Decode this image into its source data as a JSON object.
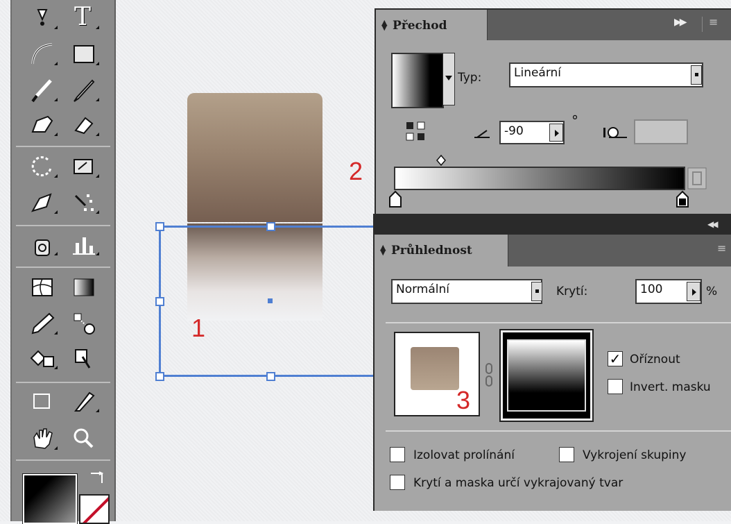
{
  "gradient_panel": {
    "tab_label": "Přechod",
    "type_label": "Typ:",
    "type_value": "Lineární",
    "angle_value": "-90",
    "degree_symbol": "°"
  },
  "transparency_panel": {
    "tab_label": "Průhlednost",
    "blend_mode": "Normální",
    "opacity_label": "Krytí:",
    "opacity_value": "100",
    "percent_sign": "%",
    "clip_label": "Oříznout",
    "clip_checked": true,
    "invert_mask_label": "Invert. masku",
    "isolate_blending_label": "Izolovat prolínání",
    "knockout_group_label": "Vykrojení skupiny",
    "opacity_mask_knockout_label": "Krytí a maska určí vykrajovaný tvar"
  },
  "callouts": {
    "one": "1",
    "two": "2",
    "three": "3"
  },
  "colors": {
    "selection": "#4f7fd2",
    "callout": "#d42828"
  },
  "toolbox": {
    "type_tool_glyph": "T"
  }
}
